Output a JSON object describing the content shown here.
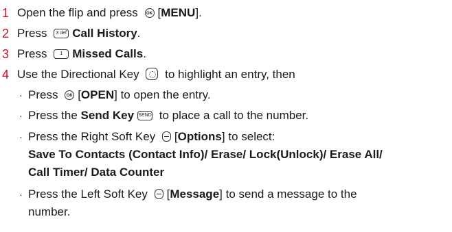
{
  "steps": [
    {
      "num": "1",
      "pre": "Open the flip and press",
      "icon": "ok-key-icon",
      "icon_text": "OK",
      "bracket_open": "[",
      "bold": "MENU",
      "bracket_close": "].",
      "post": ""
    },
    {
      "num": "2",
      "pre": "Press",
      "icon": "key-3-icon",
      "icon_text": "3 def",
      "bold": "Call History",
      "post": "."
    },
    {
      "num": "3",
      "pre": "Press",
      "icon": "key-1-icon",
      "icon_text": "1",
      "bold": "Missed Calls",
      "post": "."
    },
    {
      "num": "4",
      "pre": "Use the Directional Key",
      "icon": "directional-key-icon",
      "post": "to highlight an entry, then"
    }
  ],
  "sub_items": [
    {
      "bullet": "·",
      "pre": "Press",
      "icon": "ok-key-icon",
      "icon_text": "OK",
      "bracket_open": "[",
      "bold": "OPEN",
      "bracket_close": "]",
      "post": "to open the entry."
    },
    {
      "bullet": "·",
      "pre": "Press the",
      "bold": "Send Key",
      "icon": "send-key-icon",
      "icon_text": "SEND",
      "post": "to place a call to the number."
    },
    {
      "bullet": "·",
      "pre": "Press the Right Soft Key",
      "icon": "right-soft-key-icon",
      "bracket_open": "[",
      "bold": "Options",
      "bracket_close": "]",
      "post": "to select:",
      "line2": "Save To Contacts (Contact Info)/ Erase/ Lock(Unlock)/ Erase All/",
      "line3": "Call Timer/ Data Counter"
    },
    {
      "bullet": "·",
      "pre": "Press the Left Soft Key",
      "icon": "left-soft-key-icon",
      "bracket_open": "[",
      "bold": "Message",
      "bracket_close": "]",
      "post": "to send a message to the",
      "line2": "number."
    }
  ]
}
